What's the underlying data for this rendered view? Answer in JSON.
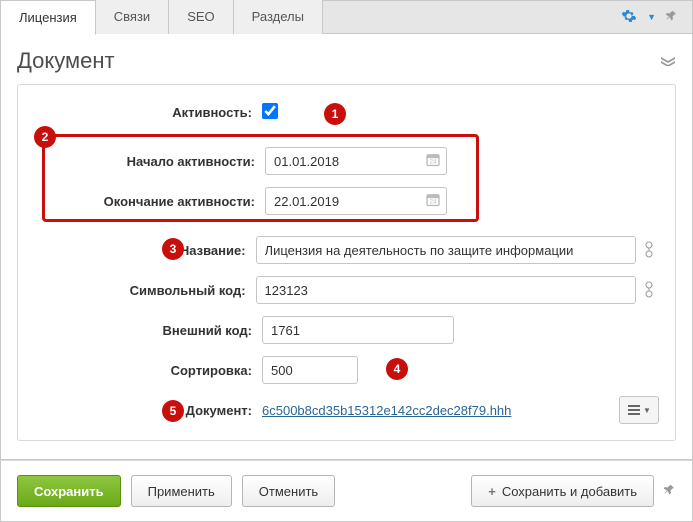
{
  "tabs": {
    "t0": "Лицензия",
    "t1": "Связи",
    "t2": "SEO",
    "t3": "Разделы"
  },
  "panel": {
    "title": "Документ"
  },
  "labels": {
    "active": "Активность:",
    "start": "Начало активности:",
    "end": "Окончание активности:",
    "name": "Название:",
    "symcode": "Символьный код:",
    "extcode": "Внешний код:",
    "sort": "Сортировка:",
    "document": "Документ:"
  },
  "values": {
    "start": "01.01.2018",
    "end": "22.01.2019",
    "name": "Лицензия на деятельность по защите информации",
    "symcode": "123123",
    "extcode": "1761",
    "sort": "500",
    "doclink": "6c500b8cd35b15312e142cc2dec28f79.hhh"
  },
  "markers": {
    "m1": "1",
    "m2": "2",
    "m3": "3",
    "m4": "4",
    "m5": "5"
  },
  "buttons": {
    "save": "Сохранить",
    "apply": "Применить",
    "cancel": "Отменить",
    "saveadd": "Сохранить и добавить"
  }
}
